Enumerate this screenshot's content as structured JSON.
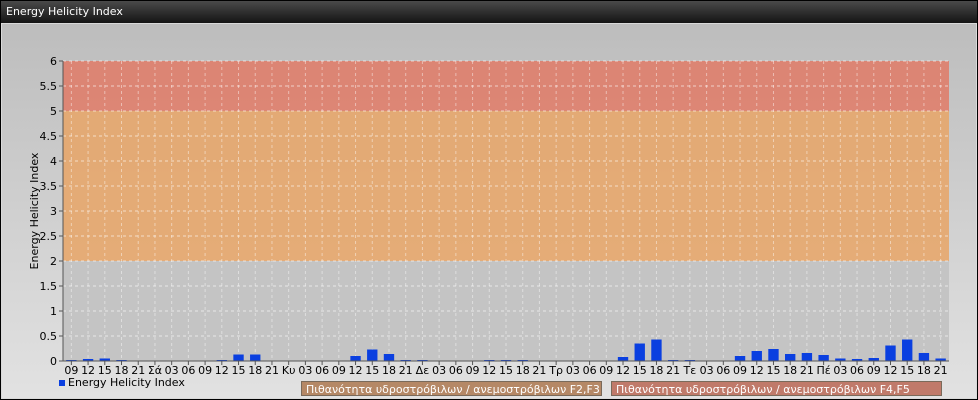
{
  "window_title": "Energy Helicity Index",
  "colors": {
    "bar": "#0a3fe0",
    "band_f2f3": "#e8a566",
    "band_f4f5": "#e07a66",
    "band_box_f2f3": "#b58866",
    "band_box_f4f5": "#c07a6a"
  },
  "bands": [
    {
      "label": "Πιθανότητα υδροστρόβιλων / ανεμοστρόβιλων F2,F3",
      "from": 2,
      "to": 5
    },
    {
      "label": "Πιθανότητα υδροστρόβιλων / ανεμοστρόβιλων F4,F5",
      "from": 5,
      "to": 6
    }
  ],
  "chart_data": {
    "type": "bar",
    "title": "",
    "ylabel": "Energy Helicity Index",
    "xlabel": "",
    "ylim": [
      0,
      6
    ],
    "yticks": [
      "0",
      "0.5",
      "1",
      "1.5",
      "2",
      "2.5",
      "3",
      "3.5",
      "4",
      "4.5",
      "5",
      "5.5",
      "6"
    ],
    "grid": true,
    "legend_position": "bottom-left",
    "categories": [
      "09",
      "12",
      "15",
      "18",
      "21",
      "Σά",
      "03",
      "06",
      "09",
      "12",
      "15",
      "18",
      "21",
      "Κυ",
      "03",
      "06",
      "09",
      "12",
      "15",
      "18",
      "21",
      "Δε",
      "03",
      "06",
      "09",
      "12",
      "15",
      "18",
      "21",
      "Τρ",
      "03",
      "06",
      "09",
      "12",
      "15",
      "18",
      "21",
      "Τε",
      "03",
      "06",
      "09",
      "12",
      "15",
      "18",
      "21",
      "Πέ",
      "03",
      "06",
      "09",
      "12",
      "15",
      "18",
      "21"
    ],
    "series": [
      {
        "name": "Energy Helicity Index",
        "values": [
          0.02,
          0.04,
          0.05,
          0.02,
          0.01,
          0.01,
          0.01,
          0.01,
          0.01,
          0.02,
          0.13,
          0.13,
          0.01,
          0.01,
          0.01,
          0.01,
          0.01,
          0.1,
          0.23,
          0.14,
          0.02,
          0.02,
          0.01,
          0.01,
          0.01,
          0.02,
          0.02,
          0.02,
          0.01,
          0.01,
          0.01,
          0.01,
          0.01,
          0.08,
          0.35,
          0.43,
          0.02,
          0.02,
          0.01,
          0.01,
          0.1,
          0.2,
          0.24,
          0.14,
          0.16,
          0.12,
          0.05,
          0.04,
          0.06,
          0.31,
          0.43,
          0.16,
          0.05
        ]
      }
    ]
  }
}
